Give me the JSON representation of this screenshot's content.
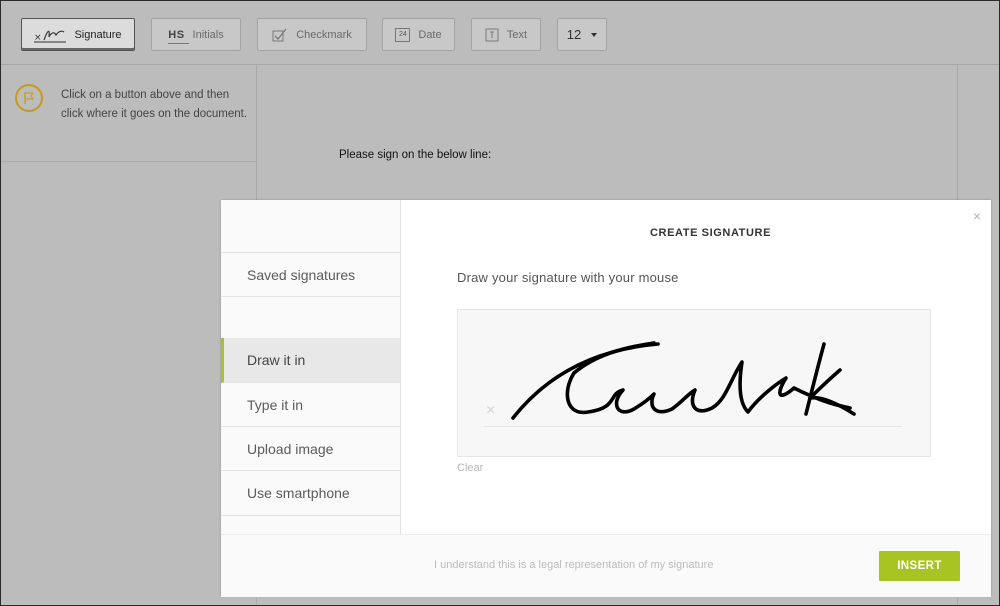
{
  "toolbar": {
    "signature_label": "Signature",
    "initials_badge": "HS",
    "initials_label": "Initials",
    "checkmark_label": "Checkmark",
    "date_badge": "24",
    "date_label": "Date",
    "text_label": "Text",
    "font_size": "12"
  },
  "sidebar": {
    "hint": "Click on a button above and then click where it goes on the document."
  },
  "document": {
    "line": "Please sign on the below line:"
  },
  "modal": {
    "title": "CREATE SIGNATURE",
    "close": "×",
    "tabs": [
      {
        "label": "Saved signatures"
      },
      {
        "label": "Draw it in"
      },
      {
        "label": "Type it in"
      },
      {
        "label": "Upload image"
      },
      {
        "label": "Use smartphone"
      }
    ],
    "active_tab": "Draw it in",
    "prompt": "Draw your signature with your mouse",
    "pad_marker": "×",
    "clear_label": "Clear",
    "legal_text": "I understand this is a legal representation of my signature",
    "insert_label": "INSERT"
  },
  "colors": {
    "accent": "#a8c423",
    "flag": "#c59a1c",
    "background": "#bcbcbc"
  },
  "icons": [
    "signature-icon",
    "checkmark-icon",
    "calendar-icon",
    "text-icon",
    "chevron-down-icon",
    "flag-icon",
    "close-icon"
  ]
}
